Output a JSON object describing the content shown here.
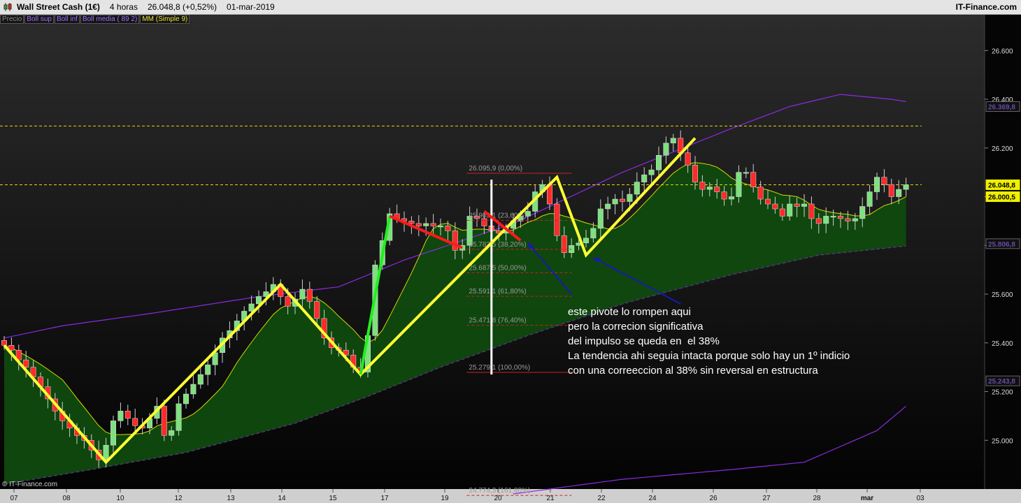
{
  "header": {
    "instrument": "Wall Street Cash (1€)",
    "timeframe": "4 horas",
    "price": "26.048,8 (+0,52%)",
    "date": "01-mar-2019",
    "site": "IT-Finance.com"
  },
  "legend": [
    {
      "label": "Precio",
      "color": "#8a8a8a"
    },
    {
      "label": "Boll sup",
      "color": "#a070ff"
    },
    {
      "label": "Boll inf",
      "color": "#a070ff"
    },
    {
      "label": "Boll media ( 89 2)",
      "color": "#a070ff"
    },
    {
      "label": "MM (Simple 9)",
      "color": "#e8e840"
    }
  ],
  "annotation": [
    "este pivote lo rompen aqui",
    "pero la correcion significativa",
    "del impulso se queda en  el 38%",
    "La tendencia ahi seguia intacta porque solo hay un 1º indicio",
    "con una correeccion al 38% sin reversal en estructura"
  ],
  "copyright": "© IT-Finance.com",
  "colors": {
    "up": "#7ee07e",
    "down": "#ff2a2a",
    "boll": "#8a2be2",
    "sma": "#d8d800",
    "fill": "#0f4a0f",
    "zigzag": "#ffff33",
    "hline": "#e8d800",
    "fib": "#cc2222",
    "arrow": "#1a1ab0"
  },
  "chart_data": {
    "type": "candlestick",
    "ylim": [
      24800,
      26750
    ],
    "y_ticks": [
      "25.000",
      "25.200",
      "25.400",
      "25.600",
      "25.800",
      "26.000",
      "26.200",
      "26.400",
      "26.600"
    ],
    "x_labels": [
      "07",
      "08",
      "10",
      "12",
      "13",
      "14",
      "15",
      "17",
      "19",
      "20",
      "21",
      "22",
      "24",
      "26",
      "27",
      "28",
      "mar",
      "03"
    ],
    "price_labels": [
      {
        "text": "26.369,8",
        "value": 26370,
        "style": "dark"
      },
      {
        "text": "26.048,8",
        "value": 26049,
        "style": "yellow"
      },
      {
        "text": "26.000,5",
        "value": 26000,
        "style": "yellow"
      },
      {
        "text": "25.806,8",
        "value": 25807,
        "style": "dark"
      },
      {
        "text": "25.243,8",
        "value": 25244,
        "style": "dark"
      }
    ],
    "horizontal_lines": [
      26290,
      26049
    ],
    "fibonacci": [
      {
        "text": "26.095,9 (0,00%)",
        "value": 26096
      },
      {
        "text": "25.903,1 (23,60%)",
        "value": 25903
      },
      {
        "text": "25.783,5 (38,20%)",
        "value": 25784
      },
      {
        "text": "25.687,5 (50,00%)",
        "value": 25688
      },
      {
        "text": "25.591,1 (61,80%)",
        "value": 25591
      },
      {
        "text": "25.471,8 (76,40%)",
        "value": 25472
      },
      {
        "text": "25.279,1 (100,00%)",
        "value": 25279
      },
      {
        "text": "24.774,3 (161,80%)",
        "value": 24774
      }
    ],
    "closes": [
      25390,
      25370,
      25330,
      25300,
      25260,
      25220,
      25170,
      25120,
      25080,
      25050,
      25020,
      25000,
      24960,
      24920,
      24980,
      25080,
      25120,
      25090,
      25060,
      25050,
      25090,
      25140,
      25020,
      25040,
      25150,
      25190,
      25230,
      25270,
      25310,
      25360,
      25420,
      25450,
      25490,
      25530,
      25560,
      25590,
      25610,
      25640,
      25590,
      25550,
      25580,
      25620,
      25570,
      25500,
      25420,
      25380,
      25370,
      25350,
      25300,
      25280,
      25430,
      25720,
      25820,
      25930,
      25910,
      25900,
      25890,
      25880,
      25890,
      25880,
      25880,
      25860,
      25780,
      25800,
      25920,
      25910,
      25880,
      25860,
      25850,
      25870,
      25900,
      25920,
      25940,
      26020,
      26050,
      25970,
      25840,
      25770,
      25800,
      25810,
      25830,
      25870,
      25950,
      25970,
      25990,
      25980,
      26010,
      26060,
      26090,
      26110,
      26170,
      26220,
      26240,
      26180,
      26130,
      26060,
      26030,
      26040,
      26020,
      25990,
      26000,
      26100,
      26100,
      26040,
      25990,
      25970,
      25950,
      25920,
      25970,
      25960,
      25970,
      25910,
      25890,
      25920,
      25920,
      25910,
      25900,
      25910,
      25960,
      26020,
      26080,
      26050,
      26000,
      26030,
      26049
    ],
    "bollinger_upper_anchors": [
      [
        0,
        25420
      ],
      [
        8,
        25470
      ],
      [
        20,
        25520
      ],
      [
        35,
        25590
      ],
      [
        46,
        25630
      ],
      [
        55,
        25740
      ],
      [
        70,
        25890
      ],
      [
        85,
        26100
      ],
      [
        100,
        26280
      ],
      [
        108,
        26370
      ],
      [
        115,
        26420
      ],
      [
        122,
        26400
      ],
      [
        128,
        26370
      ]
    ],
    "bollinger_lower_anchors": [
      [
        0,
        24820
      ],
      [
        12,
        24880
      ],
      [
        25,
        24950
      ],
      [
        40,
        25070
      ],
      [
        50,
        25180
      ],
      [
        60,
        25300
      ],
      [
        72,
        25430
      ],
      [
        85,
        25560
      ],
      [
        100,
        25680
      ],
      [
        112,
        25760
      ],
      [
        128,
        25810
      ]
    ],
    "bollinger_lower2_anchors": [
      [
        70,
        24780
      ],
      [
        85,
        24840
      ],
      [
        100,
        24880
      ],
      [
        110,
        24910
      ],
      [
        120,
        25040
      ],
      [
        128,
        25240
      ]
    ],
    "zigzag": [
      [
        0,
        25390
      ],
      [
        14,
        24910
      ],
      [
        38,
        25640
      ],
      [
        49,
        25270
      ],
      [
        76,
        26080
      ],
      [
        80,
        25760
      ],
      [
        95,
        26240
      ]
    ],
    "green_leg": [
      [
        49,
        25270
      ],
      [
        53,
        25920
      ]
    ],
    "red_legs": [
      [
        [
          53,
          25920
        ],
        [
          63,
          25790
        ]
      ],
      [
        [
          66,
          25940
        ],
        [
          71,
          25820
        ]
      ]
    ],
    "white_bar": {
      "index": 67,
      "from": 26070,
      "to": 25270
    },
    "blue_arrows": [
      {
        "from": [
          78,
          25600
        ],
        "to": [
          72,
          25810
        ]
      },
      {
        "from": [
          93,
          25560
        ],
        "to": [
          81,
          25750
        ]
      }
    ]
  }
}
